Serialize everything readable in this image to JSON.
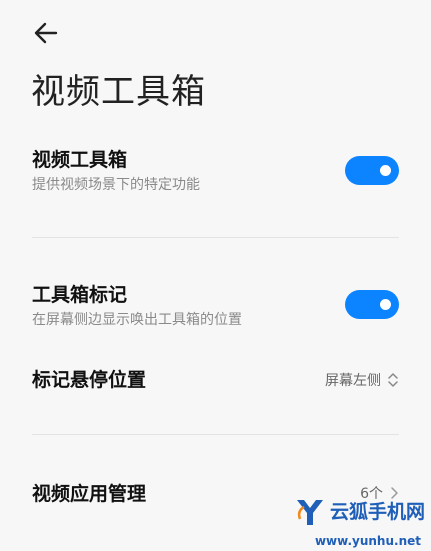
{
  "header": {
    "title": "视频工具箱"
  },
  "settings": [
    {
      "title": "视频工具箱",
      "subtitle": "提供视频场景下的特定功能",
      "enabled": true
    },
    {
      "title": "工具箱标记",
      "subtitle": "在屏幕侧边显示唤出工具箱的位置",
      "enabled": true
    }
  ],
  "position_row": {
    "label": "标记悬停位置",
    "value": "屏幕左侧"
  },
  "apps_row": {
    "label": "视频应用管理",
    "value": "6个"
  },
  "watermark": {
    "text": "云狐手机网",
    "url": "www.yunhu.net"
  },
  "colors": {
    "accent": "#0d84ff",
    "background": "#f7f7f7"
  }
}
